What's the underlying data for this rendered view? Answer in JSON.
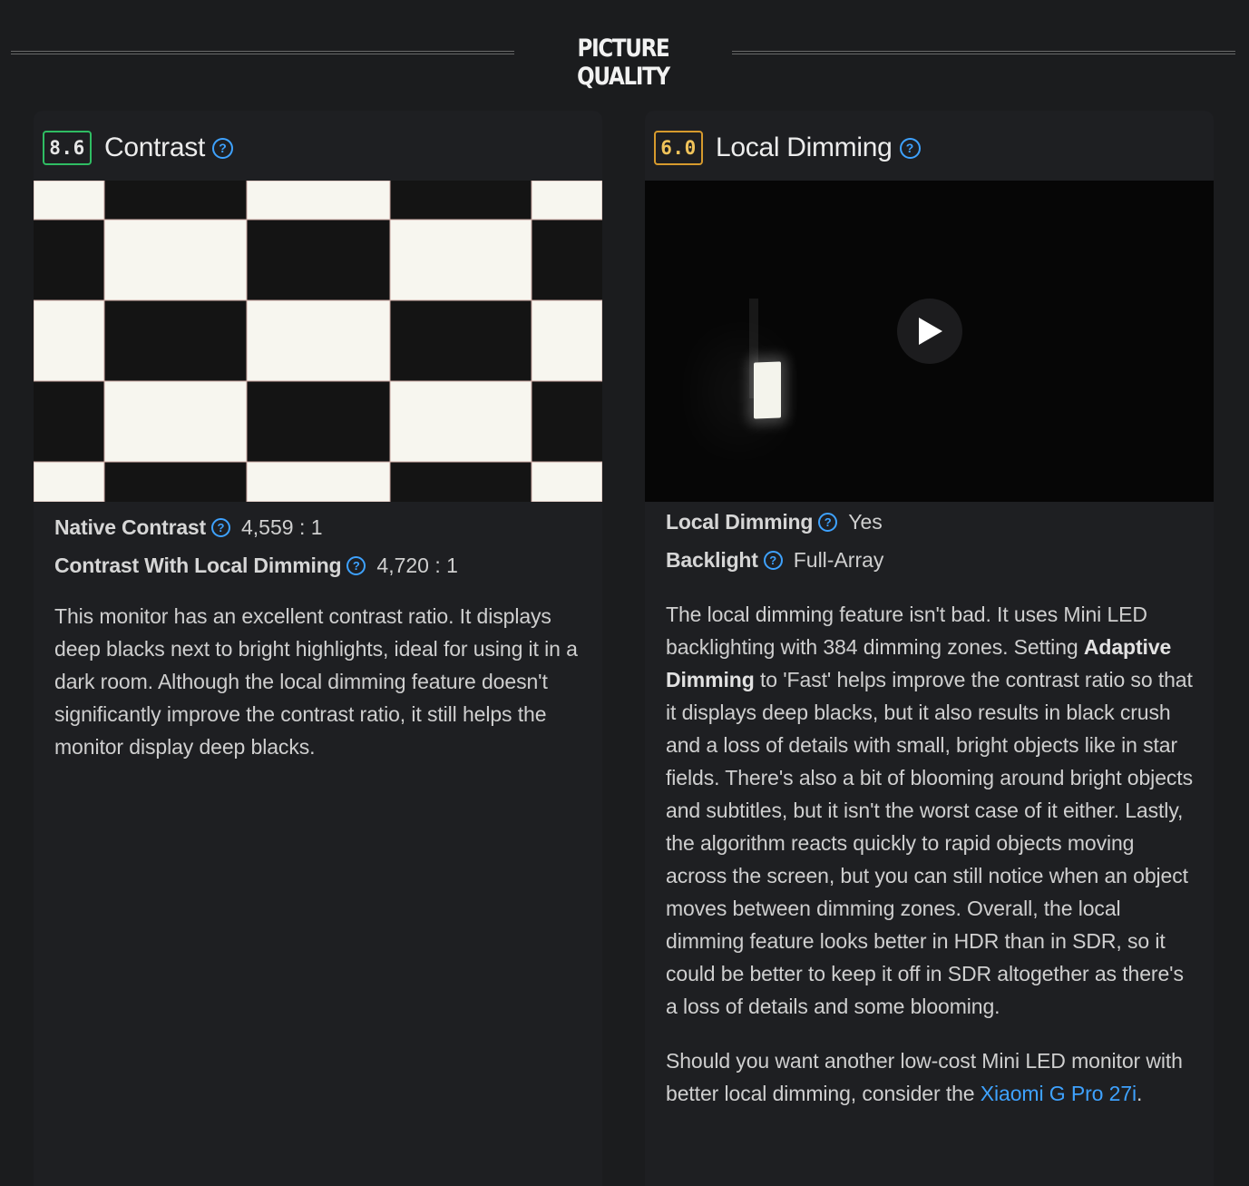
{
  "section": {
    "title": "PICTURE QUALITY"
  },
  "contrast": {
    "score": "8.6",
    "score_color": "#2fbd63",
    "title": "Contrast",
    "help_icon": "question-circle-icon",
    "specs": [
      {
        "label": "Native Contrast",
        "value": "4,559 : 1"
      },
      {
        "label": "Contrast With Local Dimming",
        "value": "4,720 : 1"
      }
    ],
    "description": "This monitor has an excellent contrast ratio. It displays deep blacks next to bright highlights, ideal for using it in a dark room. Although the local dimming feature doesn't significantly improve the contrast ratio, it still helps the monitor display deep blacks."
  },
  "local_dimming": {
    "score": "6.0",
    "score_color": "#d69a2d",
    "title": "Local Dimming",
    "help_icon": "question-circle-icon",
    "video_icon": "play-icon",
    "specs": [
      {
        "label": "Local Dimming",
        "value": "Yes"
      },
      {
        "label": "Backlight",
        "value": "Full-Array"
      }
    ],
    "description": {
      "part1": "The local dimming feature isn't bad. It uses Mini LED backlighting with 384 dimming zones. Setting ",
      "bold": "Adaptive Dimming",
      "part2": " to 'Fast' helps improve the contrast ratio so that it displays deep blacks, but it also results in black crush and a loss of details with small, bright objects like in star fields. There's also a bit of blooming around bright objects and subtitles, but it isn't the worst case of it either. Lastly, the algorithm reacts quickly to rapid objects moving across the screen, but you can still notice when an object moves between dimming zones. Overall, the local dimming feature looks better in HDR than in SDR, so it could be better to keep it off in SDR altogether as there's a loss of details and some blooming."
    },
    "recommendation": {
      "text": "Should you want another low-cost Mini LED monitor with better local dimming, consider the ",
      "link": "Xiaomi G Pro 27i",
      "end": "."
    }
  }
}
